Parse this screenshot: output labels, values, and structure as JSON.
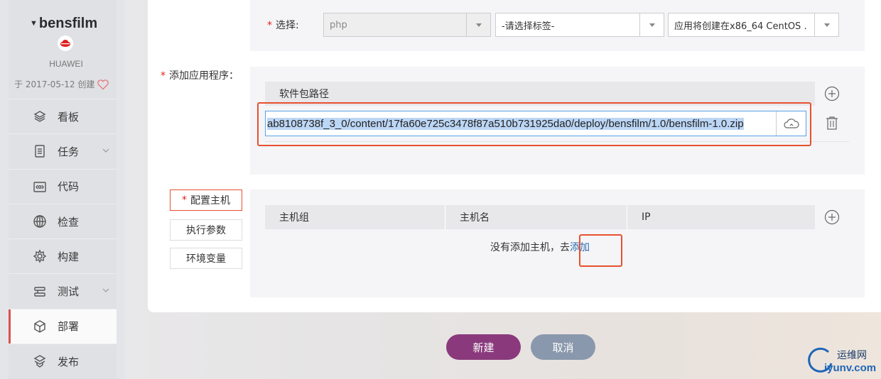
{
  "sidebar": {
    "project_name": "bensfilm",
    "org": "HUAWEI",
    "created": "于 2017-05-12 创建",
    "items": [
      {
        "label": "看板",
        "icon": "layers-icon"
      },
      {
        "label": "任务",
        "icon": "tasks-icon",
        "expandable": true
      },
      {
        "label": "代码",
        "icon": "code-icon"
      },
      {
        "label": "检查",
        "icon": "scan-icon"
      },
      {
        "label": "构建",
        "icon": "build-icon"
      },
      {
        "label": "测试",
        "icon": "test-icon",
        "expandable": true
      },
      {
        "label": "部署",
        "icon": "deploy-icon",
        "active": true
      },
      {
        "label": "发布",
        "icon": "release-icon"
      }
    ]
  },
  "form": {
    "select_label": "选择:",
    "runtime_select": "php",
    "tag_select_placeholder": "-请选择标签-",
    "env_select": "应用将创建在x86_64 CentOS ...",
    "add_app_label": "添加应用程序：",
    "package_path_header": "软件包路径",
    "package_path_value": "ab8108738f_3_0/content/17fa60e725c3478f87a510b731925da0/deploy/bensfilm/1.0/bensfilm-1.0.zip",
    "config_tabs": [
      "配置主机",
      "执行参数",
      "环境变量"
    ],
    "host_table_headers": [
      "主机组",
      "主机名",
      "IP"
    ],
    "empty_text": "没有添加主机，去",
    "add_link": "添加"
  },
  "actions": {
    "create": "新建",
    "cancel": "取消"
  },
  "watermark": {
    "name": "运维网",
    "url": "iyunv.com"
  },
  "colors": {
    "primary": "#8a3a7c",
    "secondary": "#8a98ad",
    "highlight": "#e8502f",
    "link": "#2d6bb3"
  }
}
